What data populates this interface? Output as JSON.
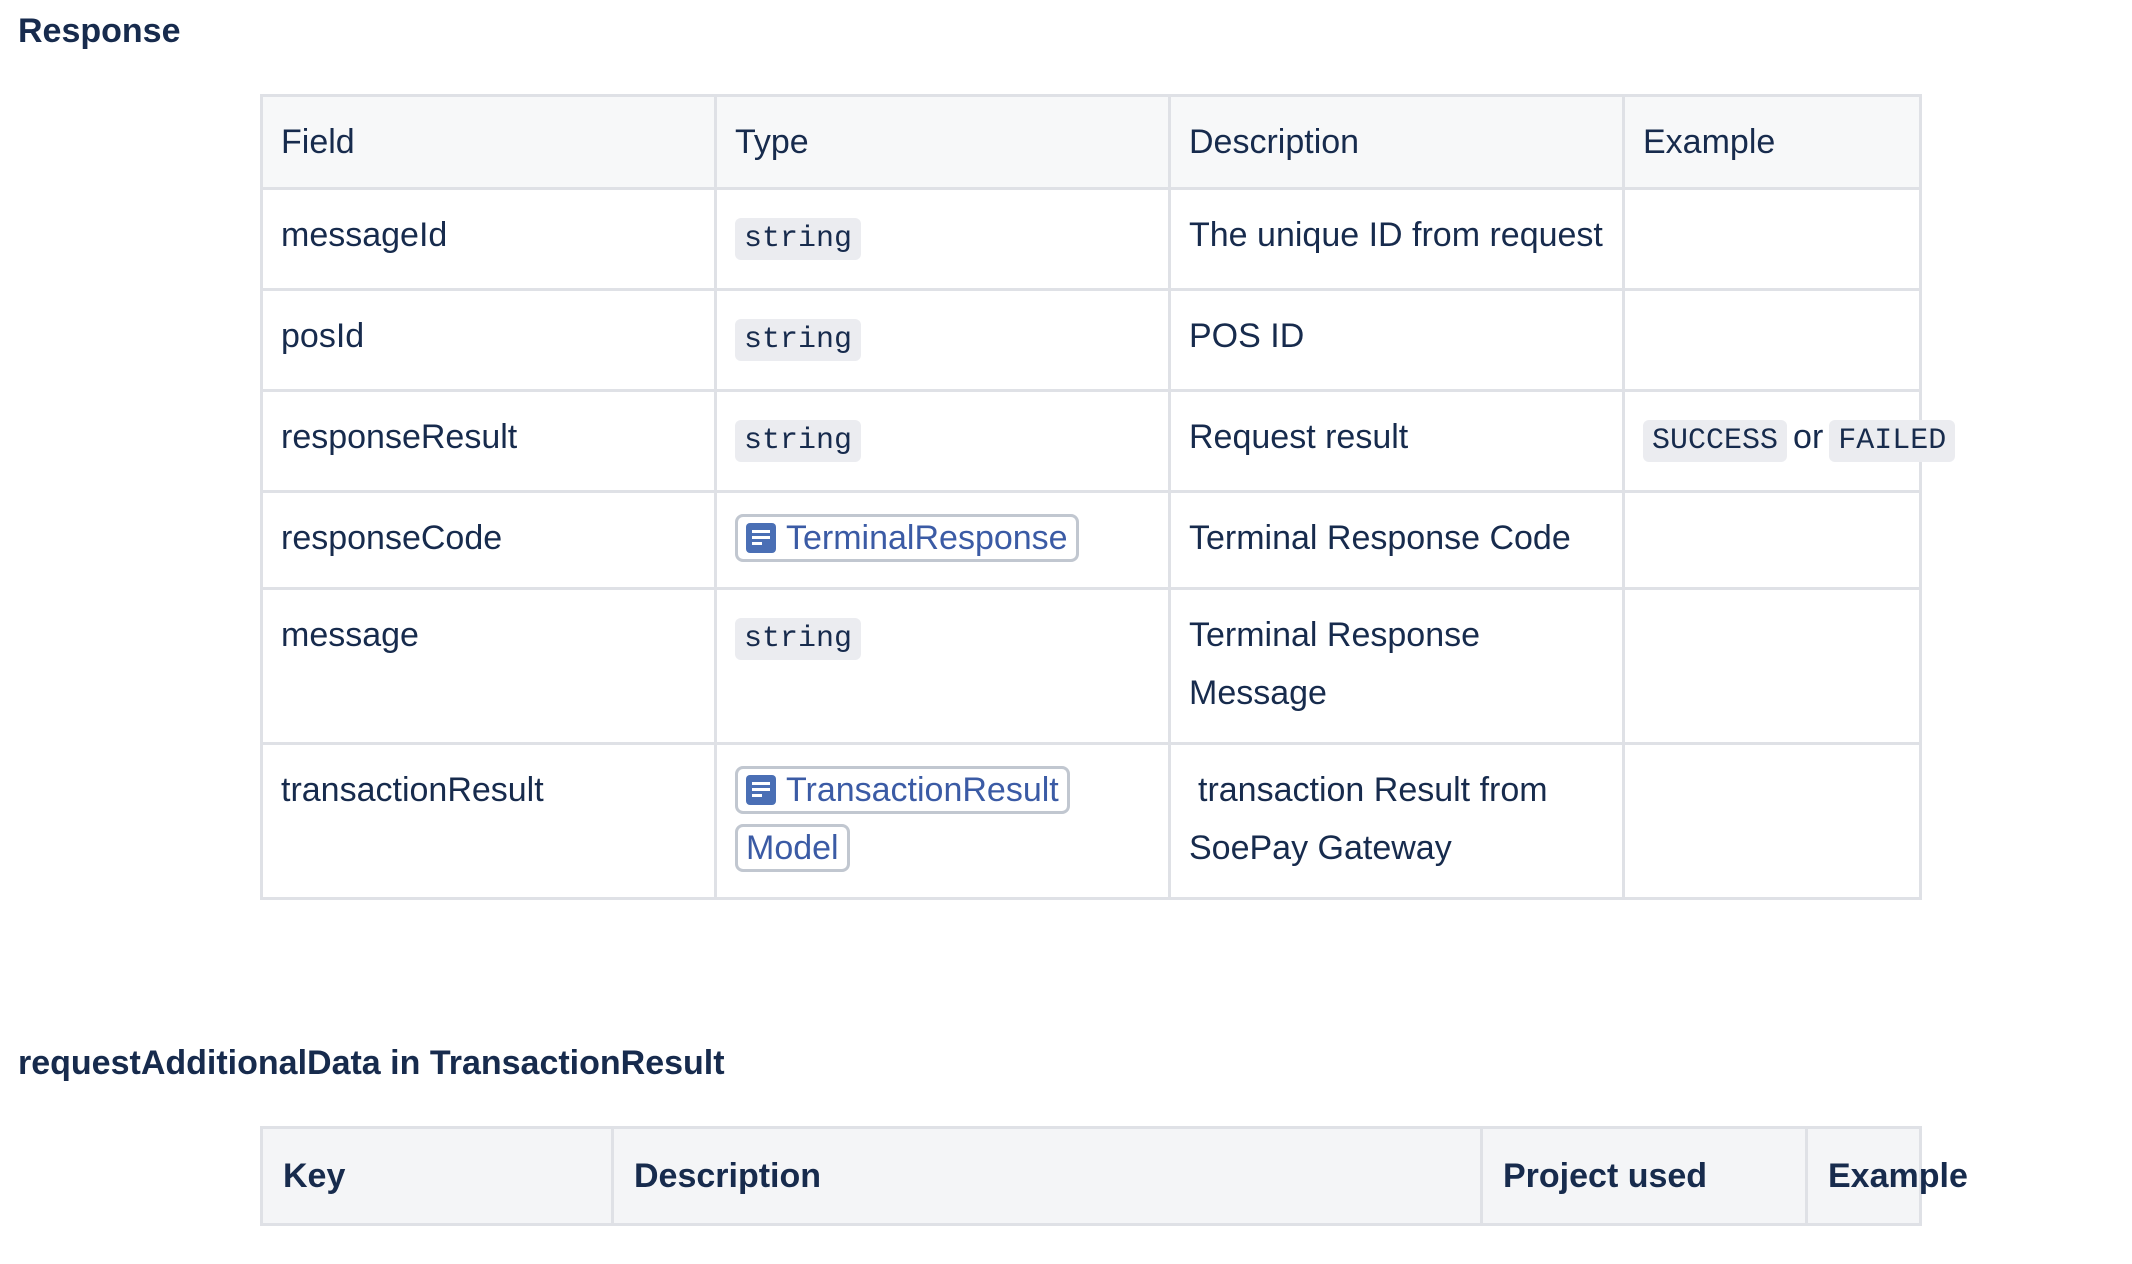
{
  "response": {
    "heading": "Response",
    "columns": [
      "Field",
      "Type",
      "Description",
      "Example"
    ],
    "rows": [
      {
        "field": "messageId",
        "type": "string",
        "description": "The unique ID from request"
      },
      {
        "field": "posId",
        "type": "string",
        "description": "POS ID"
      },
      {
        "field": "responseResult",
        "type": "string",
        "description": "Request result",
        "example_a": "SUCCESS",
        "example_sep": "or",
        "example_b": "FAILED"
      },
      {
        "field": "responseCode",
        "type_link": "TerminalResponse",
        "type_icon": "document-icon",
        "description": "Terminal Response Code"
      },
      {
        "field": "message",
        "type": "string",
        "description": "Terminal Response Message"
      },
      {
        "field": "transactionResult",
        "type_link": "TransactionResult Model",
        "type_icon": "document-icon",
        "description": "transaction Result from SoePay Gateway"
      }
    ]
  },
  "additional": {
    "heading": "requestAdditionalData in TransactionResult",
    "columns": [
      "Key",
      "Description",
      "Project used",
      "Example"
    ]
  },
  "colors": {
    "text": "#172b4d",
    "link": "#3b5ba5",
    "border": "#dfe1e6",
    "header_bg": "#f7f8f9",
    "code_bg": "#ebecf0"
  }
}
